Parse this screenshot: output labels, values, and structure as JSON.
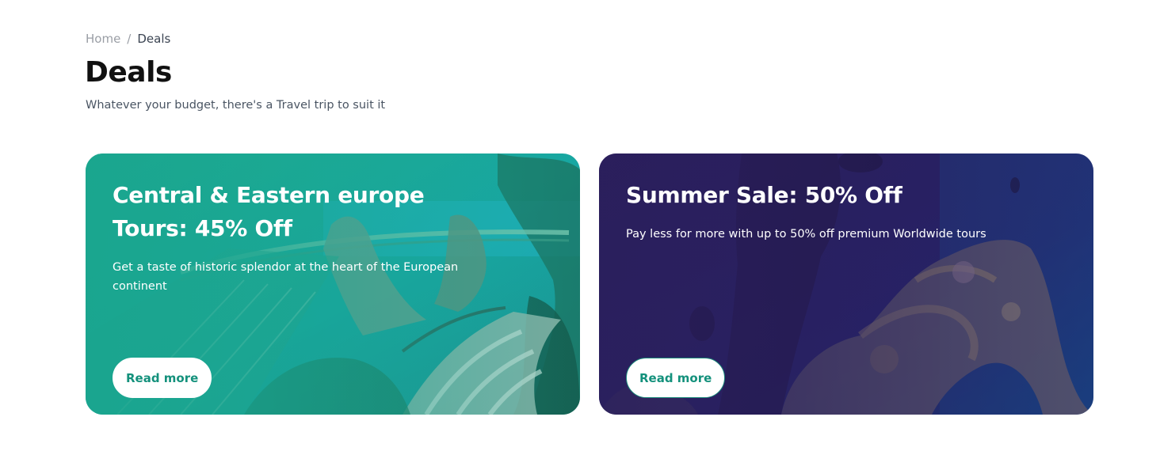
{
  "breadcrumb": {
    "home": "Home",
    "separator": "/",
    "current": "Deals"
  },
  "page": {
    "title": "Deals",
    "subtitle": "Whatever your budget, there's a Travel trip to suit it"
  },
  "deals": [
    {
      "title_line1": "Central & Eastern europe",
      "title_line2": "Tours: 45% Off",
      "description": "Get a taste of historic splendor at the heart of the European continent",
      "button_label": "Read more",
      "image": "golden-bridge-hands-photo",
      "overlay_color": "#1aa58e"
    },
    {
      "title": "Summer Sale: 50% Off",
      "description": "Pay less for more with up to 50% off premium Worldwide tours",
      "button_label": "Read more",
      "image": "scuba-diver-coral-reef-photo",
      "overlay_color": "#2b1f5c"
    }
  ],
  "colors": {
    "accent": "#14917c",
    "title": "#111111",
    "subtitle": "#4a5563",
    "breadcrumb_muted": "#9a9ea5"
  }
}
